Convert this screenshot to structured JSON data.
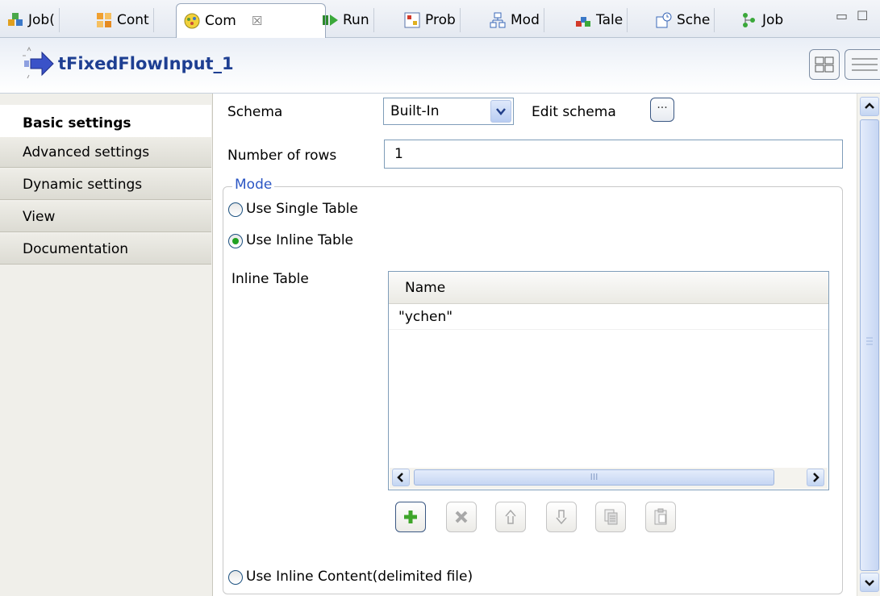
{
  "tabs": [
    {
      "label": "Job(",
      "icon": "job-icon"
    },
    {
      "label": "Cont",
      "icon": "context-icon"
    },
    {
      "label": "Com",
      "icon": "component-icon",
      "active": true,
      "close": "☒"
    },
    {
      "label": "Run",
      "icon": "run-icon"
    },
    {
      "label": "Prob",
      "icon": "problems-icon"
    },
    {
      "label": "Mod",
      "icon": "modules-icon"
    },
    {
      "label": "Tale",
      "icon": "talend-icon"
    },
    {
      "label": "Sche",
      "icon": "scheduler-icon"
    },
    {
      "label": "Job",
      "icon": "job-tree-icon"
    }
  ],
  "window_controls": {
    "minimize": "▭",
    "maximize": "☐"
  },
  "component": {
    "title": "tFixedFlowInput_1",
    "icon": "arrow-flow-icon"
  },
  "side_tabs": [
    {
      "label": "Basic settings",
      "active": true
    },
    {
      "label": "Advanced settings"
    },
    {
      "label": "Dynamic settings"
    },
    {
      "label": "View"
    },
    {
      "label": "Documentation"
    }
  ],
  "settings": {
    "schema_label": "Schema",
    "schema_value": "Built-In",
    "edit_schema_label": "Edit schema",
    "edit_schema_button": "···",
    "rows_label": "Number of rows",
    "rows_value": "1",
    "mode_legend": "Mode",
    "mode_options": [
      {
        "label": "Use Single Table",
        "checked": false
      },
      {
        "label": "Use Inline Table",
        "checked": true
      },
      {
        "label": "Use Inline Content(delimited file)",
        "checked": false
      }
    ],
    "inline_table_label": "Inline Table",
    "table": {
      "columns": [
        "Name"
      ],
      "rows": [
        [
          "\"ychen\""
        ]
      ]
    },
    "scroll_thumb_grip": "III",
    "toolbar": [
      "add-row",
      "remove-row",
      "move-up",
      "move-down",
      "copy",
      "paste"
    ]
  },
  "colors": {
    "title": "#1e3f92",
    "legend": "#2b56c4",
    "add_icon": "#3ea52a"
  }
}
